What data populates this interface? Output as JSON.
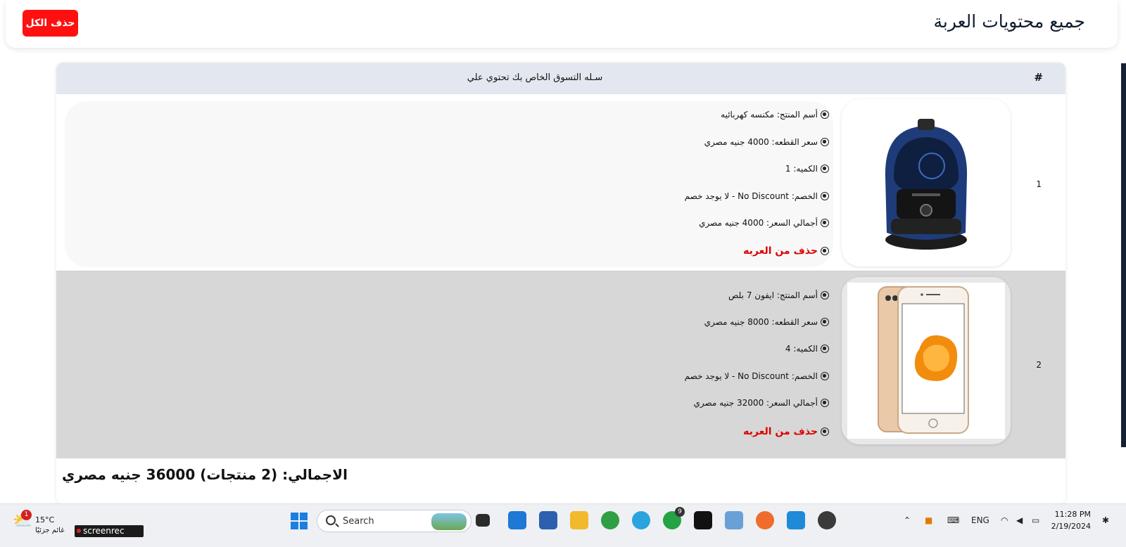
{
  "header": {
    "title": "جميع محتويات العربة",
    "delete_all_label": "حذف الكل"
  },
  "table": {
    "col_hash": "#",
    "col_title": "سـله التسوق الخاص بك تحتوي علي"
  },
  "items": [
    {
      "index": "1",
      "product_image": "vacuum-cleaner",
      "name": "أسم المنتج: مكنسه كهربائيه",
      "unit_price": "سعر القطعه: 4000 جنيه مصري",
      "quantity": "الكميه: 1",
      "discount": "الخصم: No Discount - لا يوجد خصم",
      "total_price": "أجمالي السعر: 4000 جنيه مصري",
      "remove_label": "حذف من العربه"
    },
    {
      "index": "2",
      "product_image": "iphone-7-plus",
      "name": "أسم المنتج: ايفون 7 بلص",
      "unit_price": "سعر القطعه: 8000 جنيه مصري",
      "quantity": "الكميه: 4",
      "discount": "الخصم: No Discount - لا يوجد خصم",
      "total_price": "أجمالي السعر: 32000 جنيه مصري",
      "remove_label": "حذف من العربه"
    }
  ],
  "summary": {
    "total_text": "الاجمالي: (2 منتجات) 36000 جنيه مصري"
  },
  "colors": {
    "danger": "#ff1010",
    "table_header": "#e3e8f0",
    "row_alt": "#d7d7d7",
    "remove_text": "#e00000"
  },
  "taskbar": {
    "weather_temp": "15°C",
    "weather_desc": "غائم جزئيًا",
    "weather_badge": "1",
    "screenrec_label": "screenrec",
    "search_label": "Search",
    "whatsapp_badge": "9",
    "lang": "ENG",
    "time": "11:28 PM",
    "date": "2/19/2024",
    "apps": [
      "windows-start-icon",
      "search-icon",
      "task-view-icon",
      "mail-icon",
      "store-icon",
      "file-explorer-icon",
      "chrome-icon",
      "telegram-icon",
      "whatsapp-icon",
      "pycharm-icon",
      "network-app-icon",
      "postman-icon",
      "vscode-icon",
      "app-icon"
    ]
  }
}
